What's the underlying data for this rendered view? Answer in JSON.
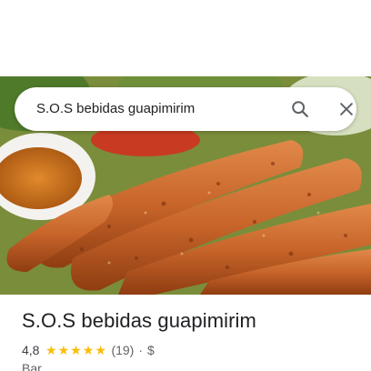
{
  "search": {
    "query": "S.O.S bebidas guapimirim",
    "search_icon": "search-icon",
    "close_icon": "close-icon"
  },
  "hero": {
    "image_subject": "grilled kebab skewers with dipping sauce"
  },
  "place": {
    "title": "S.O.S bebidas guapimirim",
    "rating": "4,8",
    "rating_stars": 5,
    "reviews": "(19)",
    "separator": "·",
    "price": "$",
    "category": "Bar"
  },
  "colors": {
    "star": "#fbbc04",
    "text_primary": "#202124",
    "text_secondary": "#5f6368"
  }
}
